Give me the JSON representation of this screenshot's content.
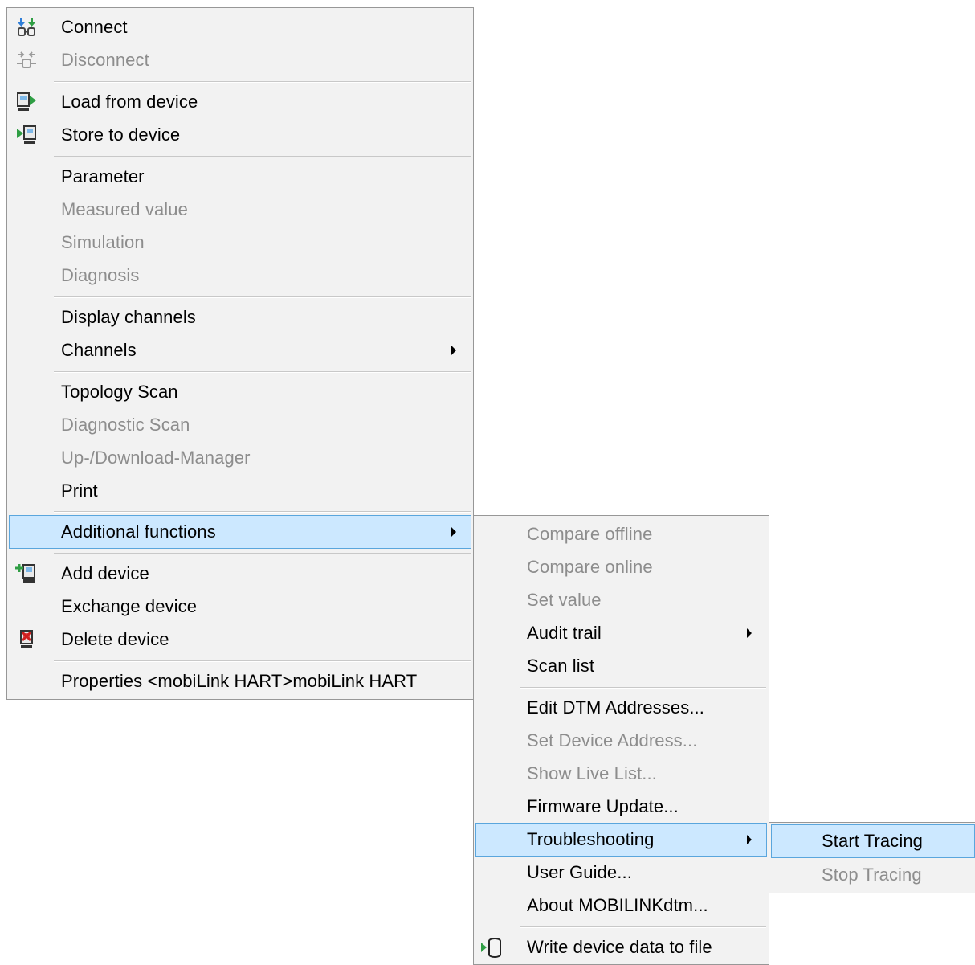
{
  "main_menu": {
    "items": [
      {
        "label": "Connect",
        "icon": "connect-icon"
      },
      {
        "label": "Disconnect",
        "icon": "disconnect-icon"
      },
      {
        "label": "Load from device",
        "icon": "load-from-device-icon"
      },
      {
        "label": "Store to device",
        "icon": "store-to-device-icon"
      },
      {
        "label": "Parameter"
      },
      {
        "label": "Measured value"
      },
      {
        "label": "Simulation"
      },
      {
        "label": "Diagnosis"
      },
      {
        "label": "Display channels"
      },
      {
        "label": "Channels"
      },
      {
        "label": "Topology Scan"
      },
      {
        "label": "Diagnostic Scan"
      },
      {
        "label": "Up-/Download-Manager"
      },
      {
        "label": "Print"
      },
      {
        "label": "Additional functions"
      },
      {
        "label": "Add device",
        "icon": "add-device-icon"
      },
      {
        "label": "Exchange device"
      },
      {
        "label": "Delete device",
        "icon": "delete-device-icon"
      },
      {
        "label": "Properties <mobiLink HART>mobiLink HART"
      }
    ]
  },
  "additional_functions_menu": {
    "items": [
      {
        "label": "Compare offline"
      },
      {
        "label": "Compare online"
      },
      {
        "label": "Set value"
      },
      {
        "label": "Audit trail"
      },
      {
        "label": "Scan list"
      },
      {
        "label": "Edit DTM Addresses..."
      },
      {
        "label": "Set Device Address..."
      },
      {
        "label": "Show Live List..."
      },
      {
        "label": "Firmware Update..."
      },
      {
        "label": "Troubleshooting"
      },
      {
        "label": "User Guide..."
      },
      {
        "label": "About MOBILINKdtm..."
      },
      {
        "label": "Write device data to file",
        "icon": "write-to-file-icon"
      }
    ]
  },
  "troubleshooting_menu": {
    "items": [
      {
        "label": "Start Tracing"
      },
      {
        "label": "Stop Tracing"
      }
    ]
  },
  "colors": {
    "highlight_bg": "#cce8ff",
    "highlight_border": "#5aa6dd",
    "disabled_text": "#8d8d8d",
    "menu_bg": "#f2f2f2"
  }
}
